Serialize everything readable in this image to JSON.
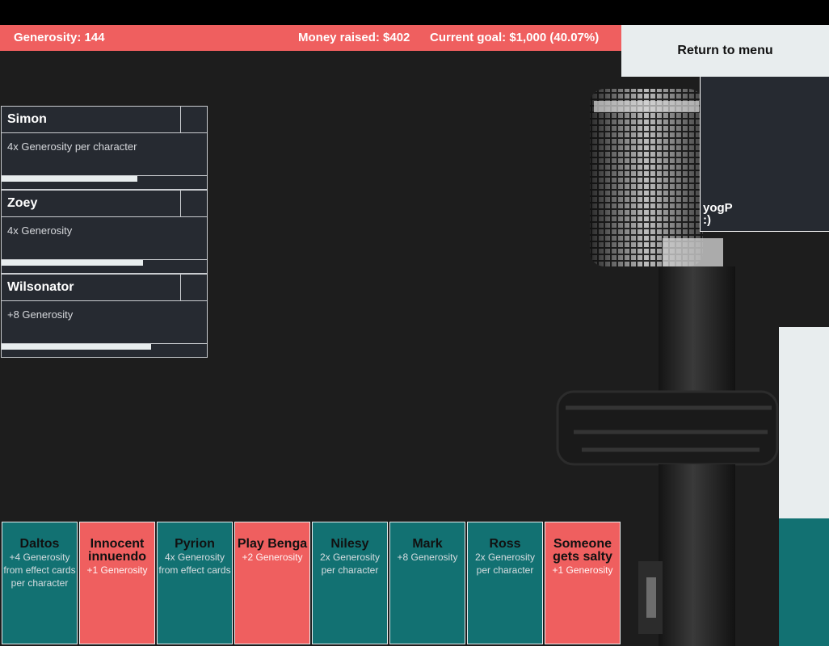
{
  "hud": {
    "generosity": "Generosity: 144",
    "money_raised": "Money raised: $402",
    "current_goal": "Current goal: $1,000 (40.07%)"
  },
  "menu": {
    "return_label": "Return to menu"
  },
  "player": {
    "name": "yogP",
    "status": ":)"
  },
  "goal_progress": 0.4007,
  "colors": {
    "accent_red": "#ef5f5f",
    "teal": "#127172",
    "panel": "#262a31",
    "light": "#e8edee"
  },
  "characters": [
    {
      "name": "Simon",
      "effect": "4x Generosity per character",
      "progress": 0.66
    },
    {
      "name": "Zoey",
      "effect": "4x Generosity",
      "progress": 0.69
    },
    {
      "name": "Wilsonator",
      "effect": "+8 Generosity",
      "progress": 0.73
    }
  ],
  "cards": [
    {
      "title": "Daltos",
      "text": "+4 Generosity from effect cards per character",
      "color": "teal"
    },
    {
      "title": "Innocent innuendo",
      "text": "+1 Generosity",
      "color": "red"
    },
    {
      "title": "Pyrion",
      "text": "4x Generosity from effect cards",
      "color": "teal"
    },
    {
      "title": "Play Benga",
      "text": "+2 Generosity",
      "color": "red"
    },
    {
      "title": "Nilesy",
      "text": "2x Generosity per character",
      "color": "teal"
    },
    {
      "title": "Mark",
      "text": "+8 Generosity",
      "color": "teal"
    },
    {
      "title": "Ross",
      "text": "2x Generosity per character",
      "color": "teal"
    },
    {
      "title": "Someone gets salty",
      "text": "+1 Generosity",
      "color": "red"
    }
  ]
}
